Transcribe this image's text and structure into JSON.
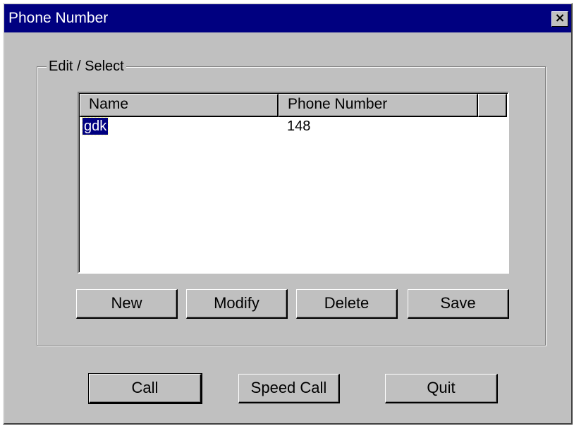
{
  "window": {
    "title": "Phone Number",
    "close_glyph": "×"
  },
  "group": {
    "label": "Edit / Select"
  },
  "list": {
    "columns": [
      "Name",
      "Phone Number",
      ""
    ],
    "rows": [
      {
        "name": "gdk",
        "phone": "148",
        "selected": true
      }
    ]
  },
  "edit_buttons": {
    "new": "New",
    "modify": "Modify",
    "delete": "Delete",
    "save": "Save"
  },
  "action_buttons": {
    "call": "Call",
    "speed_call": "Speed Call",
    "quit": "Quit"
  },
  "colors": {
    "titlebar": "#000080",
    "face": "#c0c0c0",
    "selection": "#000080"
  }
}
